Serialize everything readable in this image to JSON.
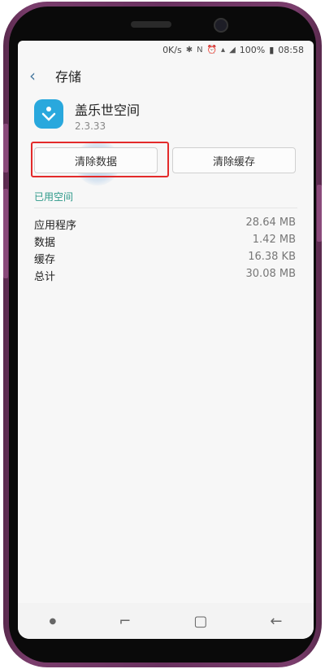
{
  "status_bar": {
    "net_speed": "0K/s",
    "battery": "100%",
    "time": "08:58"
  },
  "app_bar": {
    "title": "存储"
  },
  "app": {
    "name": "盖乐世空间",
    "version": "2.3.33"
  },
  "buttons": {
    "clear_data": "清除数据",
    "clear_cache": "清除缓存"
  },
  "section_title": "已用空间",
  "storage_rows": [
    {
      "label": "应用程序",
      "value": "28.64 MB"
    },
    {
      "label": "数据",
      "value": "1.42 MB"
    },
    {
      "label": "缓存",
      "value": "16.38 KB"
    },
    {
      "label": "总计",
      "value": "30.08 MB"
    }
  ],
  "colors": {
    "accent": "#2e9a8a",
    "highlight": "#e32a2a",
    "app_icon": "#29a8dd"
  },
  "icons": {
    "back": "back-arrow-icon",
    "recent": "recent-apps-icon",
    "home": "home-icon",
    "nav_back": "nav-back-icon"
  }
}
